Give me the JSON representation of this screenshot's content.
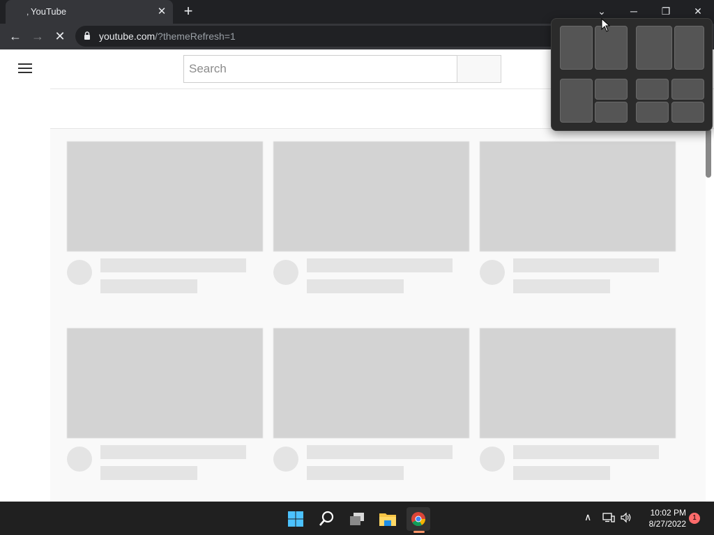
{
  "browser": {
    "tab_title": "YouTube",
    "tab_close": "✕",
    "new_tab": "+",
    "url_domain": "youtube.com",
    "url_rest": "/?themeRefresh=1",
    "back_icon": "←",
    "forward_icon": "→",
    "reload_icon": "✕"
  },
  "window_controls": {
    "dropdown": "⌄",
    "minimize": "─",
    "restore": "❐",
    "close": "✕"
  },
  "youtube": {
    "search_placeholder": "Search"
  },
  "snap_layouts": [
    "two-column",
    "two-wide-left",
    "three-mixed",
    "four-grid"
  ],
  "taskbar": {
    "apps": [
      "start-icon",
      "search-icon",
      "task-view-icon",
      "file-explorer-icon",
      "chrome-icon"
    ],
    "time": "10:02 PM",
    "date": "8/27/2022",
    "notification_count": "1",
    "tray_chevron": "∧"
  },
  "colors": {
    "accent_indicator": "#ff9568",
    "chrome_dark": "#202124",
    "tab_active": "#35363a",
    "placeholder_gray": "#d3d3d3"
  }
}
